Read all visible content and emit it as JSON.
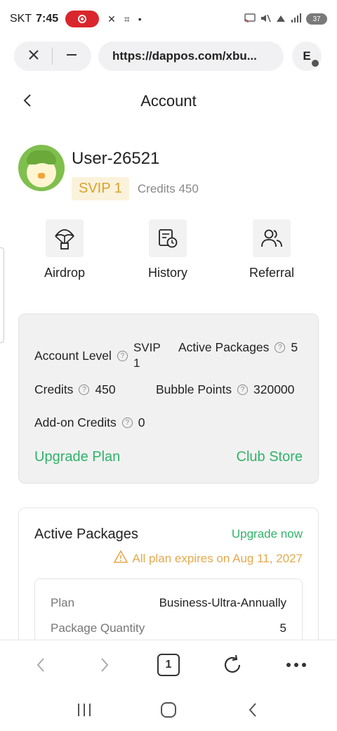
{
  "status_bar": {
    "carrier": "SKT",
    "time": "7:45",
    "battery": "37"
  },
  "browser": {
    "url": "https://dappos.com/xbu...",
    "profile_letter": "E",
    "tab_count": "1"
  },
  "page": {
    "title": "Account"
  },
  "profile": {
    "username": "User-26521",
    "svip": "SVIP 1",
    "credits": "Credits 450"
  },
  "quick_actions": {
    "airdrop": "Airdrop",
    "history": "History",
    "referral": "Referral"
  },
  "stats": {
    "account_level_label": "Account Level",
    "account_level_value_line1": "SVIP",
    "account_level_value_line2": "1",
    "active_packages_label": "Active Packages",
    "active_packages_value": "5",
    "credits_label": "Credits",
    "credits_value": "450",
    "bubble_points_label": "Bubble Points",
    "bubble_points_value": "320000",
    "addon_label": "Add-on Credits",
    "addon_value": "0",
    "upgrade_plan": "Upgrade Plan",
    "club_store": "Club Store"
  },
  "packages": {
    "title": "Active Packages",
    "upgrade_now": "Upgrade now",
    "expiry": "All plan expires on Aug 11, 2027",
    "plan_label": "Plan",
    "plan_value": "Business-Ultra-Annually",
    "quantity_label": "Package Quantity",
    "quantity_value": "5"
  },
  "colors": {
    "accent_green": "#2fb36a",
    "svip_gold": "#d9a22a",
    "warning_orange": "#e6a84c",
    "record_red": "#d9262c"
  }
}
